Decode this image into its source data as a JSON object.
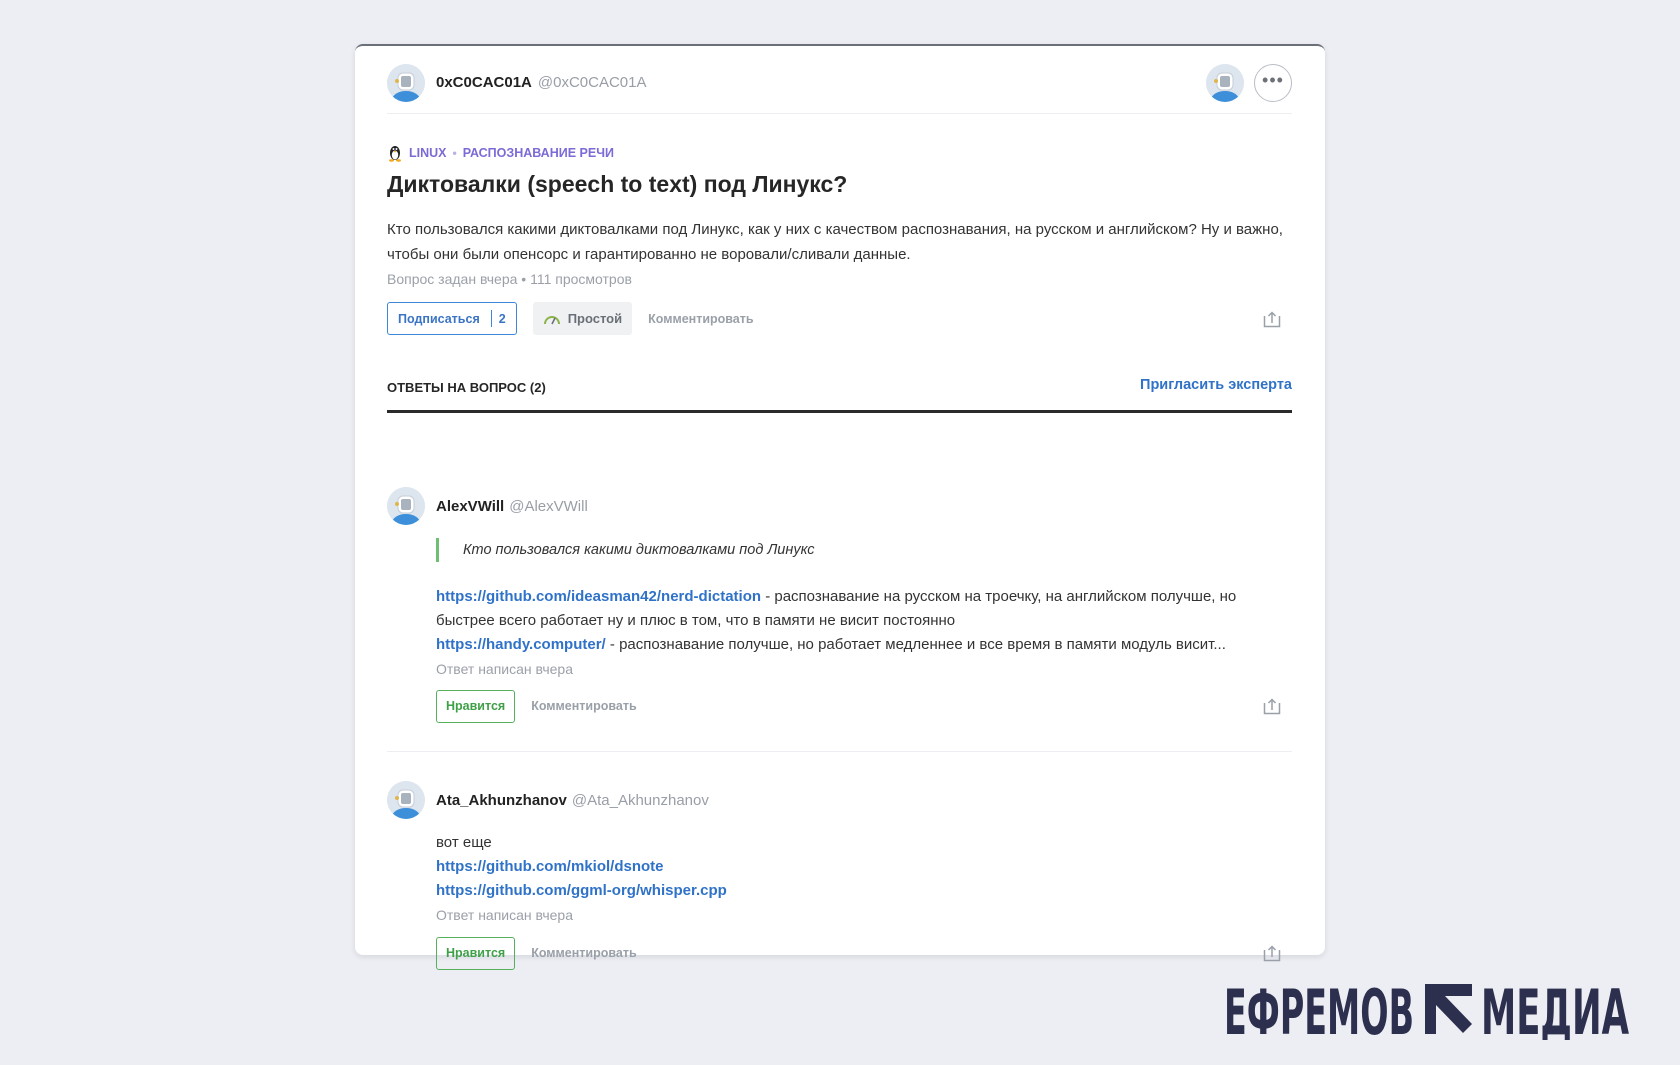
{
  "question": {
    "author": {
      "name": "0xC0CAC01A",
      "nick": "@0xC0CAC01A"
    },
    "tags": [
      "LINUX",
      "РАСПОЗНАВАНИЕ РЕЧИ"
    ],
    "title": "Диктовалки (speech to text) под Линукс?",
    "body": "Кто пользовался какими диктовалками под Линукс, как у них с качеством распознавания, на русском и английском? Ну и важно, чтобы они были опенсорс и гарантированно не воровали/сливали данные.",
    "meta": "Вопрос задан вчера • 111 просмотров",
    "subscribe_label": "Подписаться",
    "subscribe_count": "2",
    "level_label": "Простой",
    "comment_label": "Комментировать"
  },
  "answers_header": {
    "title": "ОТВЕТЫ НА ВОПРОС (2)",
    "invite_label": "Пригласить эксперта"
  },
  "answers": [
    {
      "name": "AlexVWill",
      "nick": "@AlexVWill",
      "quote": "Кто пользовался какими диктовалками под Линукс",
      "link1": "https://github.com/ideasman42/nerd-dictation",
      "text1": " - распознавание на русском на троечку, на английском получше, но быстрее всего работает ну и плюс в том, что в памяти не висит постоянно",
      "link2": "https://handy.computer/",
      "text2": " - распознавание получше, но работает медленнее и все время в памяти модуль висит...",
      "meta": "Ответ написан вчера",
      "like_label": "Нравится",
      "comment_label": "Комментировать"
    },
    {
      "name": "Ata_Akhunzhanov",
      "nick": "@Ata_Akhunzhanov",
      "text": "вот еще",
      "link1": "https://github.com/mkiol/dsnote",
      "link2": "https://github.com/ggml-org/whisper.cpp",
      "meta": "Ответ написан вчера",
      "like_label": "Нравится",
      "comment_label": "Комментировать"
    }
  ],
  "watermark": "ЕФРЕМОВ МЕДИА",
  "colors": {
    "accent_blue": "#2f72c8",
    "tag_purple": "#7c6ad6",
    "like_green": "#3fa047",
    "logo_navy": "#2d2f4e"
  },
  "icons": [
    "user-avatar-icon",
    "more-dots-icon",
    "tux-icon",
    "speedometer-icon",
    "share-icon",
    "logo-arrow-icon"
  ]
}
